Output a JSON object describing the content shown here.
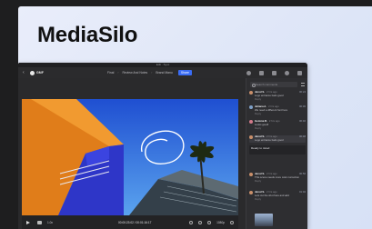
{
  "brand": {
    "title": "MediaSilo"
  },
  "window": {
    "title": "Edit · Sync"
  },
  "toolbar": {
    "back_icon": "chevron-left-icon",
    "app_label": "GMF",
    "breadcrumb": [
      "Final",
      "Review And Notes",
      "Brand Manu"
    ],
    "share_label": "Share"
  },
  "player": {
    "speed": "1.0x",
    "timecode": "00:00:23:02 / 00:01:16:17",
    "quality": "1080p",
    "progress_fraction": 0.22
  },
  "panel": {
    "search_placeholder": "Search comments",
    "comments": [
      {
        "name": "Jarod S.",
        "time": "2 hrs ago",
        "tc": "00:24",
        "body": "Logo entrance feels good",
        "reply": "Reply"
      },
      {
        "name": "Juliana A.",
        "time": "2 hrs ago",
        "tc": "00:30",
        "body": "We need a different font here",
        "reply": "Reply"
      },
      {
        "name": "Gemma R.",
        "time": "2 hrs ago",
        "tc": "00:40",
        "body": "Looks good!",
        "reply": "Reply"
      },
      {
        "name": "Jarod S.",
        "time": "2 hrs ago",
        "tc": "00:48",
        "body": "Logo entrance feels good",
        "reply": ""
      },
      {
        "name": "Jarod S.",
        "time": "2 hrs ago",
        "tc": "00:56",
        "body": "This scene needs more color correction",
        "reply": "Reply"
      },
      {
        "name": "Jarod S.",
        "time": "2 hrs ago",
        "tc": "01:02",
        "body": "Lets cut the shot here and add",
        "reply": "Reply"
      }
    ],
    "reply_box_text": "Ready to Jared"
  }
}
